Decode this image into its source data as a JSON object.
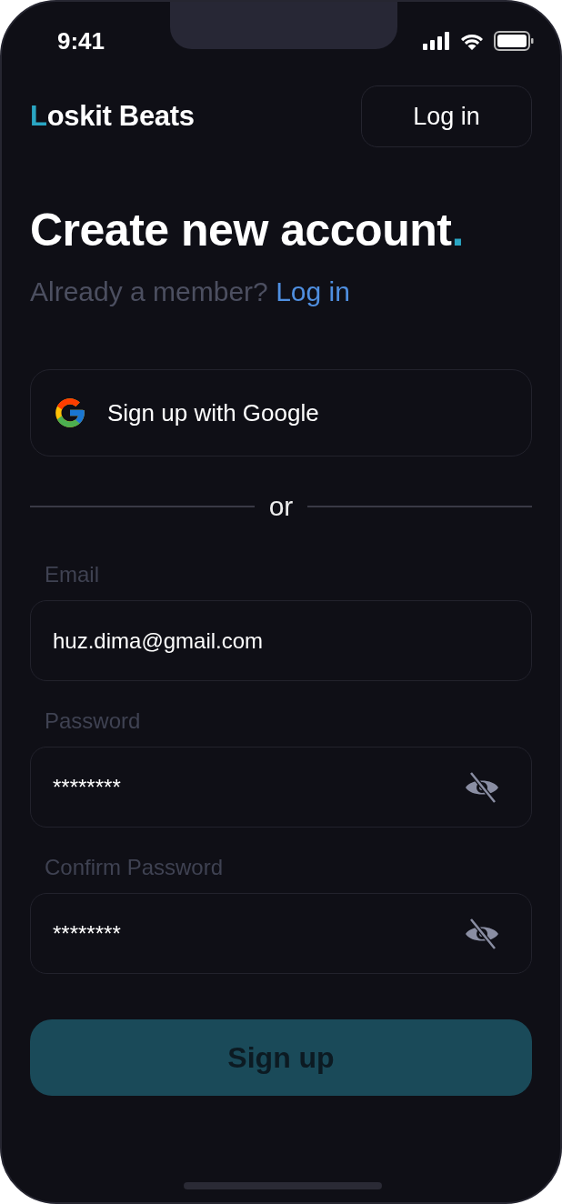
{
  "status_bar": {
    "time": "9:41"
  },
  "header": {
    "brand": {
      "initial": "L",
      "rest": "oskit Beats"
    },
    "login_button": "Log in"
  },
  "title": {
    "text": "Create new account",
    "end_mark": "."
  },
  "subtitle": {
    "text": "Already a member?",
    "link": "Log in"
  },
  "google_button": "Sign up with Google",
  "divider": "or",
  "fields": [
    {
      "kind": "text",
      "label": "Email",
      "value": "huz.dima@gmail.com"
    },
    {
      "kind": "password",
      "label": "Password",
      "value": "********"
    },
    {
      "kind": "password",
      "label": "Confirm Password",
      "value": "********"
    }
  ],
  "submit": {
    "label": "Sign up",
    "disabled": true
  }
}
